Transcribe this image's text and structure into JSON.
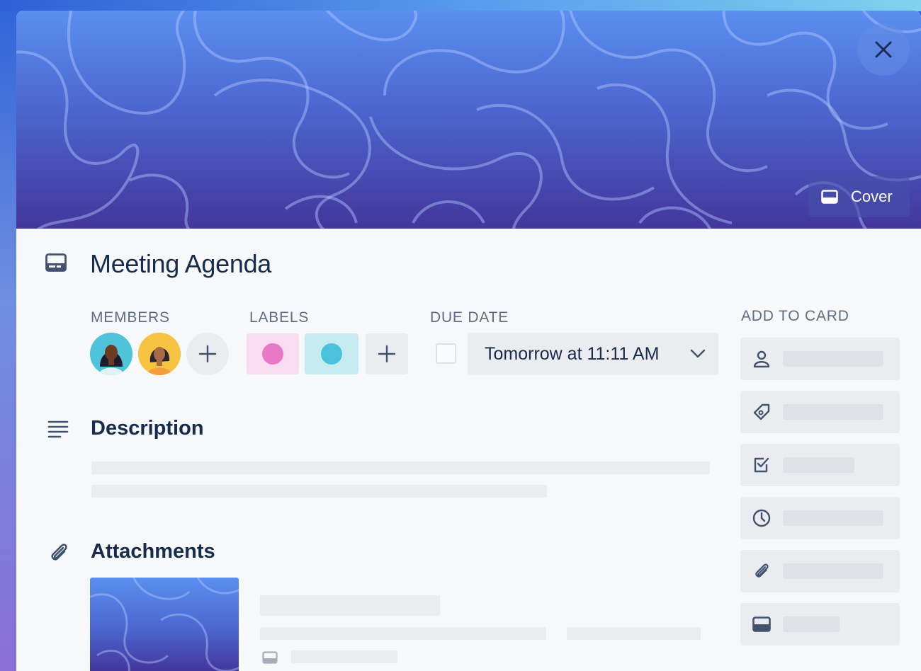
{
  "card": {
    "title": "Meeting Agenda",
    "cover_button_label": "Cover"
  },
  "members": {
    "label": "MEMBERS",
    "avatars": [
      {
        "name": "member-avatar-1",
        "bg": "#4fc3d9"
      },
      {
        "name": "member-avatar-2",
        "bg": "#f6c343"
      }
    ]
  },
  "labels": {
    "label": "LABELS",
    "items": [
      {
        "chip_color": "#f9dcef",
        "dot_color": "#e879c7"
      },
      {
        "chip_color": "#c6ecf2",
        "dot_color": "#4cc3dd"
      }
    ]
  },
  "due_date": {
    "label": "DUE DATE",
    "value": "Tomorrow at 11:11 AM",
    "completed": false
  },
  "description": {
    "title": "Description"
  },
  "attachments": {
    "title": "Attachments"
  },
  "add_to_card": {
    "label": "ADD TO CARD",
    "items": [
      {
        "icon": "person-icon"
      },
      {
        "icon": "tag-icon"
      },
      {
        "icon": "checklist-icon"
      },
      {
        "icon": "clock-icon"
      },
      {
        "icon": "paperclip-icon"
      },
      {
        "icon": "card-cover-icon"
      }
    ]
  },
  "colors": {
    "text_primary": "#172b4d",
    "text_subtle": "#5e6c84",
    "surface": "#f7f8fa",
    "skeleton": "#ebecf0"
  }
}
